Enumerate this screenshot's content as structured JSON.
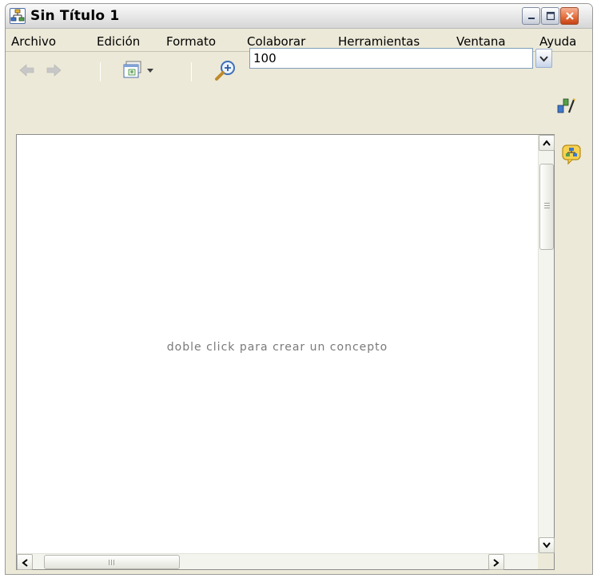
{
  "window": {
    "title": "Sin Título 1",
    "controls": {
      "minimize": "minimize-icon",
      "maximize": "maximize-icon",
      "close": "close-icon"
    }
  },
  "menu": {
    "items": [
      "Archivo",
      "Edición",
      "Formato",
      "Colaborar",
      "Herramientas",
      "Ventana",
      "Ayuda"
    ]
  },
  "toolbar": {
    "back_icon": "back-arrow-icon",
    "forward_icon": "forward-arrow-icon",
    "view_icon": "view-options-icon",
    "zoom_icon": "zoom-in-icon",
    "zoom_value": "100",
    "style_icon": "style-palette-icon"
  },
  "canvas": {
    "hint": "doble click para crear un concepto"
  },
  "side_panel": {
    "icon": "concept-map-icon"
  },
  "colors": {
    "chrome": "#ece9d8",
    "canvas": "#ffffff",
    "hint_text": "#7a7a7a",
    "close_button": "#e5713f"
  }
}
